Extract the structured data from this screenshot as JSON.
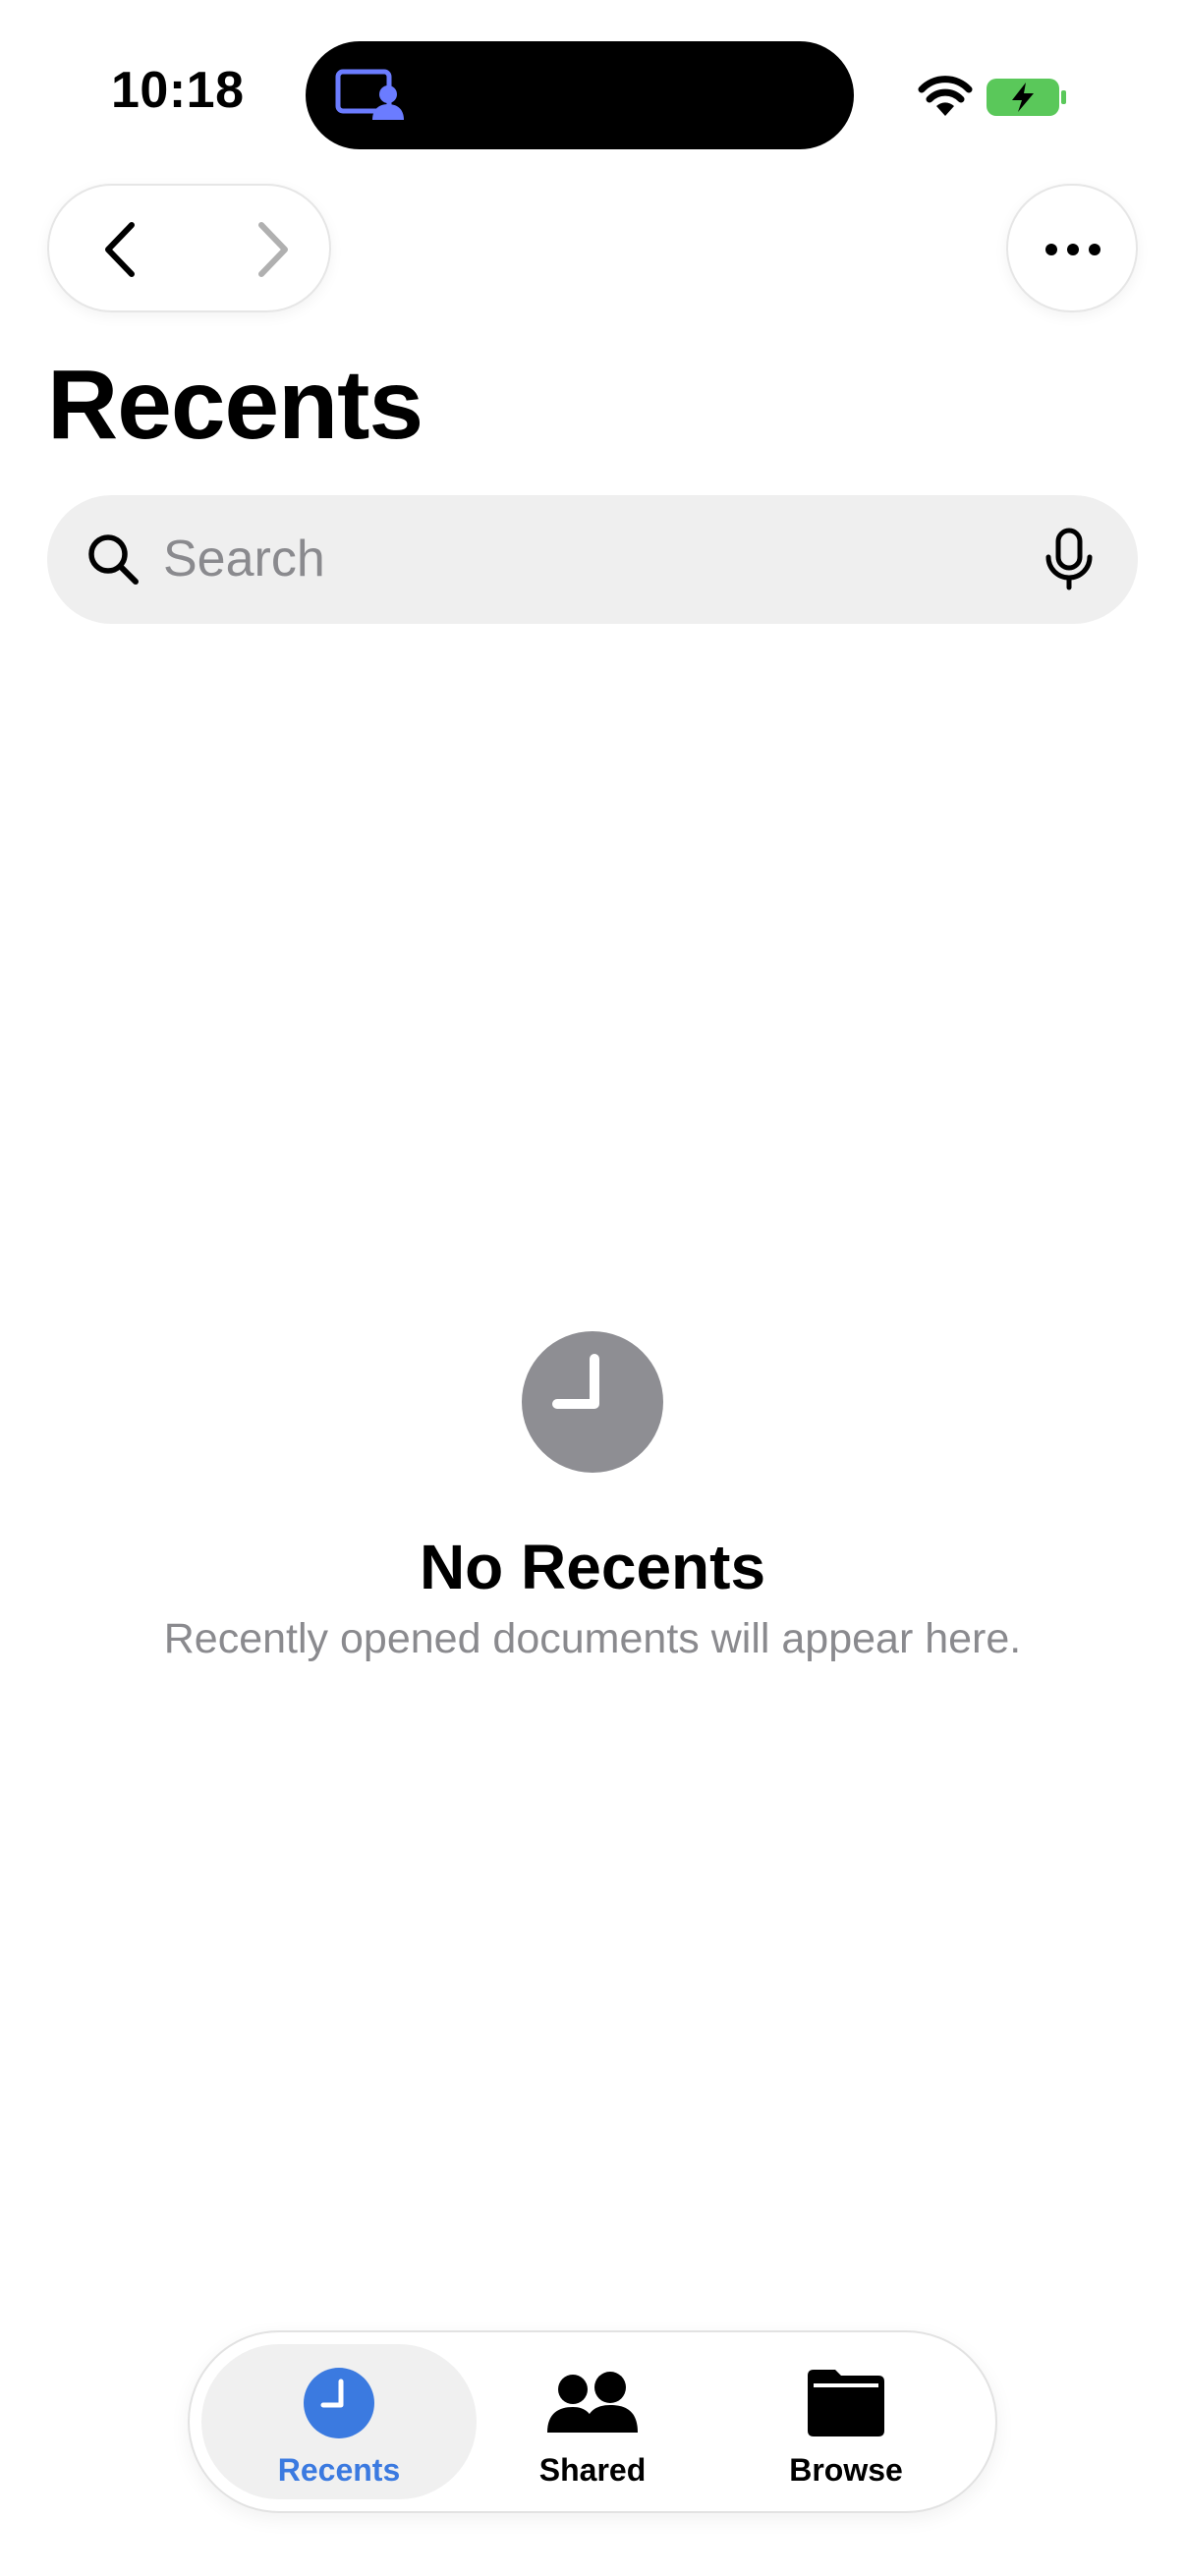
{
  "status_bar": {
    "time": "10:18"
  },
  "header": {
    "title": "Recents"
  },
  "search": {
    "placeholder": "Search",
    "value": ""
  },
  "empty_state": {
    "title": "No Recents",
    "subtitle": "Recently opened documents will appear here."
  },
  "tab_bar": {
    "selected": "Recents",
    "tabs": [
      {
        "label": "Recents",
        "icon": "clock-icon"
      },
      {
        "label": "Shared",
        "icon": "people-icon"
      },
      {
        "label": "Browse",
        "icon": "folder-icon"
      }
    ]
  },
  "colors": {
    "accent": "#3b7ae0",
    "empty_icon": "#8e8e93",
    "battery": "#5ac85a",
    "island_icon": "#6b7cff"
  }
}
